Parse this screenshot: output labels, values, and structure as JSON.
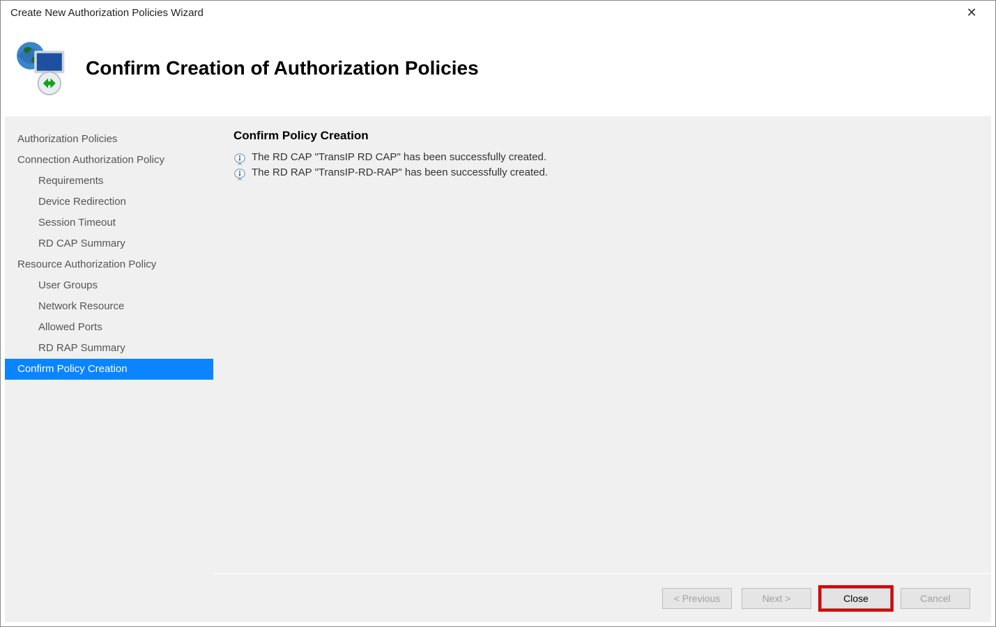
{
  "window": {
    "title": "Create New Authorization Policies Wizard",
    "close_symbol": "✕"
  },
  "header": {
    "title": "Confirm Creation of Authorization Policies"
  },
  "sidebar": {
    "items": [
      {
        "label": "Authorization Policies",
        "indent": 0,
        "active": false
      },
      {
        "label": "Connection Authorization Policy",
        "indent": 0,
        "active": false
      },
      {
        "label": "Requirements",
        "indent": 1,
        "active": false
      },
      {
        "label": "Device Redirection",
        "indent": 1,
        "active": false
      },
      {
        "label": "Session Timeout",
        "indent": 1,
        "active": false
      },
      {
        "label": "RD CAP Summary",
        "indent": 1,
        "active": false
      },
      {
        "label": "Resource Authorization Policy",
        "indent": 0,
        "active": false
      },
      {
        "label": "User Groups",
        "indent": 1,
        "active": false
      },
      {
        "label": "Network Resource",
        "indent": 1,
        "active": false
      },
      {
        "label": "Allowed Ports",
        "indent": 1,
        "active": false
      },
      {
        "label": "RD RAP Summary",
        "indent": 1,
        "active": false
      },
      {
        "label": "Confirm Policy Creation",
        "indent": 0,
        "active": true
      }
    ]
  },
  "content": {
    "heading": "Confirm Policy Creation",
    "messages": [
      {
        "icon": "info",
        "text": "The RD CAP \"TransIP RD CAP\" has been successfully created."
      },
      {
        "icon": "info",
        "text": "The RD RAP \"TransIP-RD-RAP\" has been successfully created."
      }
    ]
  },
  "footer": {
    "previous": "< Previous",
    "next": "Next >",
    "close": "Close",
    "cancel": "Cancel"
  }
}
